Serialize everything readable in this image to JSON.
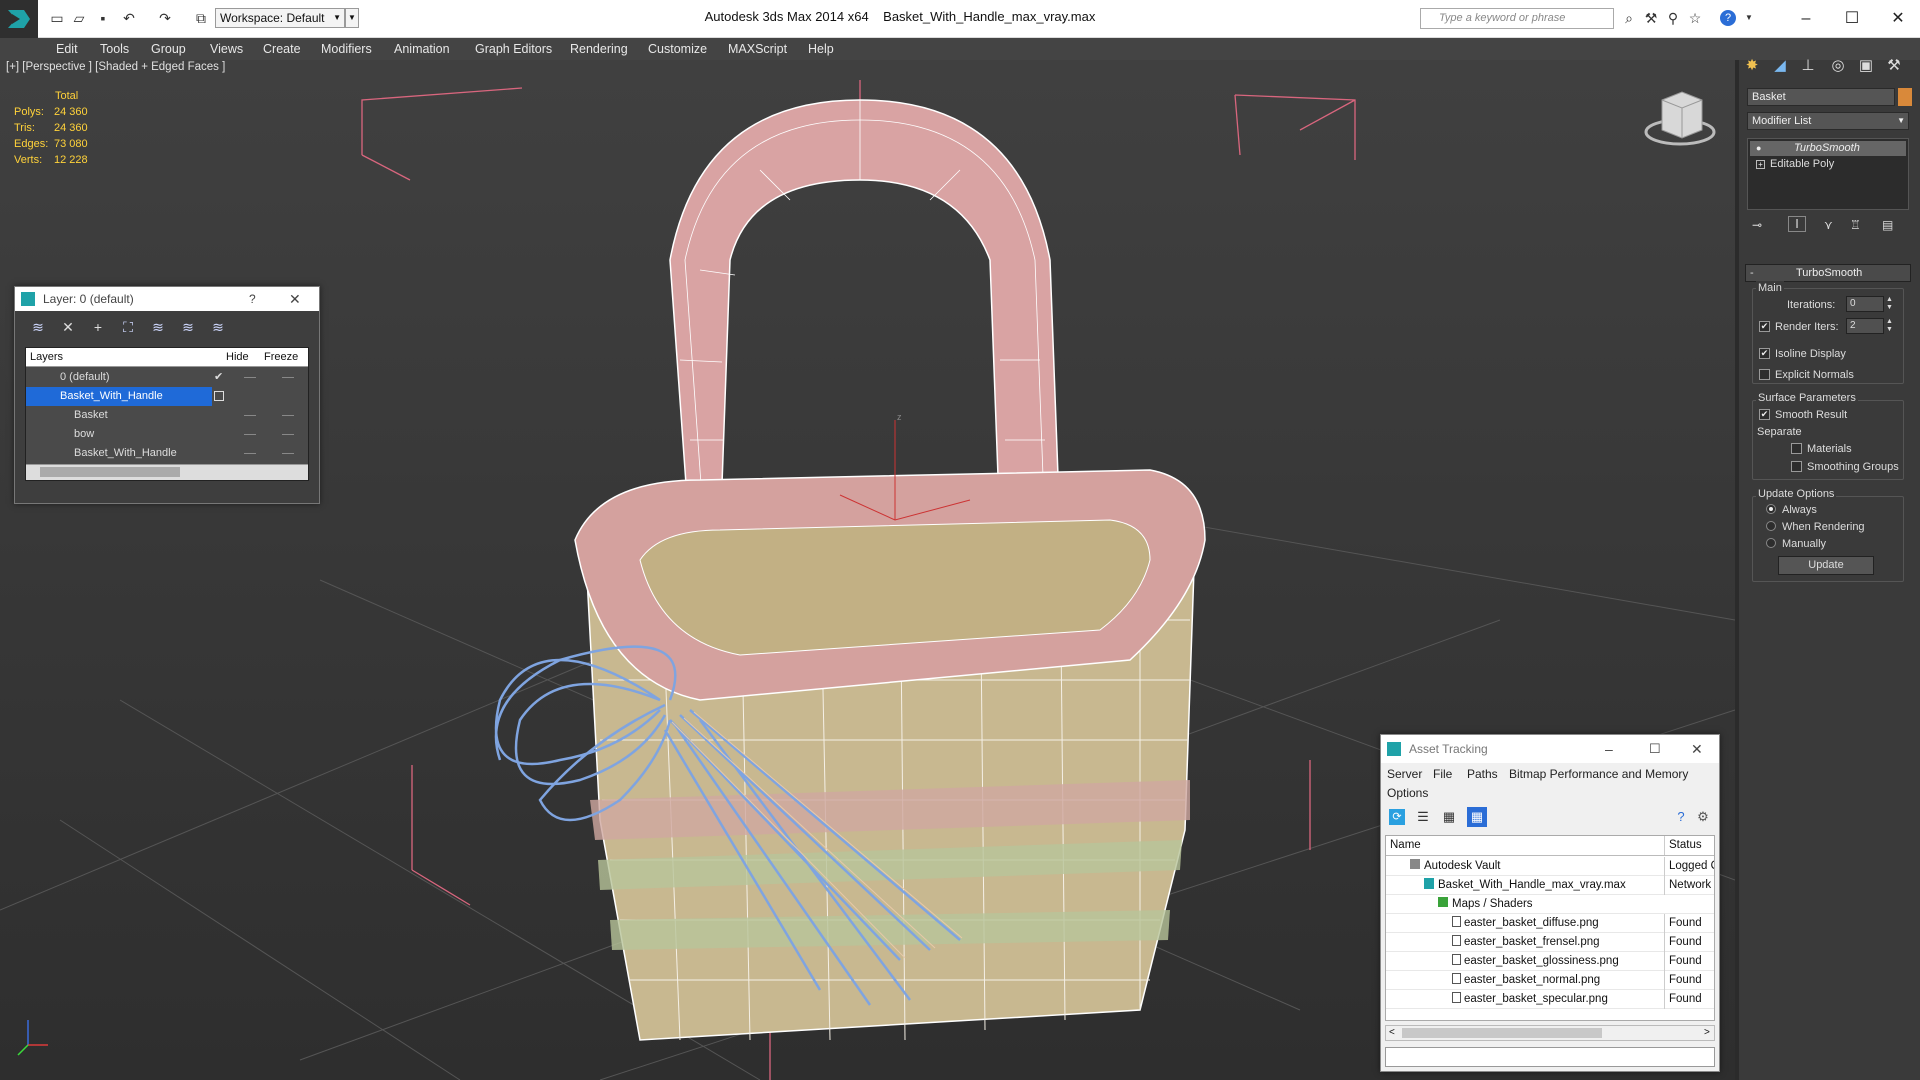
{
  "titlebar": {
    "workspace": "Workspace: Default",
    "app_title": "Autodesk 3ds Max  2014 x64",
    "file_title": "Basket_With_Handle_max_vray.max",
    "search_placeholder": "Type a keyword or phrase"
  },
  "menubar": {
    "items": [
      "Edit",
      "Tools",
      "Group",
      "Views",
      "Create",
      "Modifiers",
      "Animation",
      "Graph Editors",
      "Rendering",
      "Customize",
      "MAXScript",
      "Help"
    ]
  },
  "viewport": {
    "label": "[+] [Perspective ] [Shaded + Edged Faces ]",
    "stats": {
      "header": "Total",
      "rows": [
        {
          "label": "Polys:",
          "value": "24 360"
        },
        {
          "label": "Tris:",
          "value": "24 360"
        },
        {
          "label": "Edges:",
          "value": "73 080"
        },
        {
          "label": "Verts:",
          "value": "12 228"
        }
      ]
    }
  },
  "layer_window": {
    "title": "Layer: 0 (default)",
    "help": "?",
    "columns": {
      "layers": "Layers",
      "hide": "Hide",
      "freeze": "Freeze"
    },
    "rows": [
      "0 (default)",
      "Basket_With_Handle",
      "Basket",
      "bow",
      "Basket_With_Handle"
    ]
  },
  "command_panel": {
    "object_name": "Basket",
    "object_color": "#d9893a",
    "modifier_list": "Modifier List",
    "stack": [
      "TurboSmooth",
      "Editable Poly"
    ],
    "rollout_title": "TurboSmooth",
    "main_label": "Main",
    "iterations_label": "Iterations:",
    "iterations_value": "0",
    "render_iters_label": "Render Iters:",
    "render_iters_value": "2",
    "isoline_label": "Isoline Display",
    "explicit_normals_label": "Explicit Normals",
    "surface_params_label": "Surface Parameters",
    "smooth_result_label": "Smooth Result",
    "separate_label": "Separate",
    "materials_label": "Materials",
    "smoothing_groups_label": "Smoothing Groups",
    "update_options_label": "Update Options",
    "always_label": "Always",
    "when_rendering_label": "When Rendering",
    "manually_label": "Manually",
    "update_button": "Update"
  },
  "asset_tracking": {
    "title": "Asset Tracking",
    "menu": [
      "Server",
      "File",
      "Paths",
      "Bitmap Performance and Memory",
      "Options"
    ],
    "columns": {
      "name": "Name",
      "status": "Status"
    },
    "rows": [
      {
        "name": "Autodesk Vault",
        "status": "Logged Ou"
      },
      {
        "name": "Basket_With_Handle_max_vray.max",
        "status": "Network P"
      },
      {
        "name": "Maps / Shaders",
        "status": ""
      },
      {
        "name": "easter_basket_diffuse.png",
        "status": "Found"
      },
      {
        "name": "easter_basket_frensel.png",
        "status": "Found"
      },
      {
        "name": "easter_basket_glossiness.png",
        "status": "Found"
      },
      {
        "name": "easter_basket_normal.png",
        "status": "Found"
      },
      {
        "name": "easter_basket_specular.png",
        "status": "Found"
      }
    ]
  }
}
